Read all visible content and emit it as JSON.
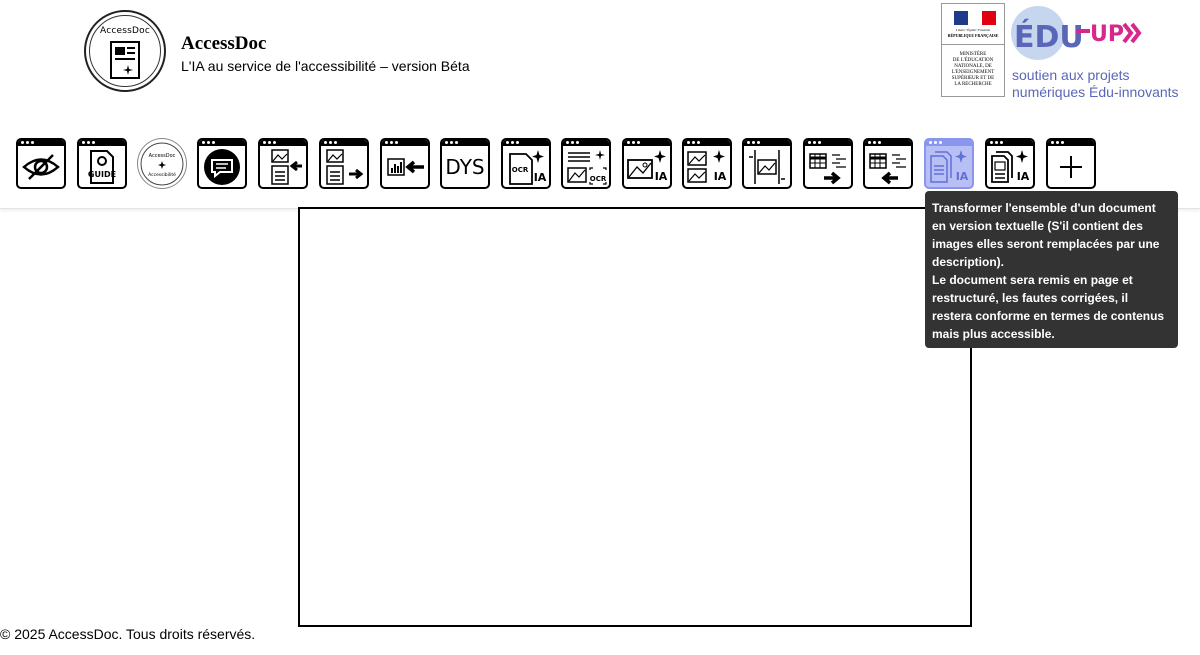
{
  "header": {
    "logo_text": "AccessDoc",
    "title": "AccessDoc",
    "subtitle": "L'IA au service de l'accessibilité – version Béta",
    "republic_logo": {
      "motto": "Liberté • Égalité • Fraternité",
      "republic": "RÉPUBLIQUE FRANÇAISE",
      "ministry": "MINISTÈRE\nDE L'ÉDUCATION\nNATIONALE, DE\nL'ENSEIGNEMENT\nSUPÉRIEUR ET DE\nLA RECHERCHE"
    },
    "eduup": {
      "name": "ÉDU-UP",
      "tagline_line1": "soutien aux projets",
      "tagline_line2": "numériques Édu-innovants"
    }
  },
  "toolbar": {
    "tools": [
      {
        "icon": "eye-slash-icon"
      },
      {
        "icon": "guide-icon",
        "label": "GUIDE"
      },
      {
        "icon": "accessdoc-logo-icon",
        "label": "AccessDoc"
      },
      {
        "icon": "chat-bubble-icon"
      },
      {
        "icon": "image-to-text-icon"
      },
      {
        "icon": "text-to-image-icon"
      },
      {
        "icon": "chart-to-text-icon"
      },
      {
        "icon": "dys-icon",
        "label": "DYS"
      },
      {
        "icon": "ocr-ia-icon",
        "label": "IA"
      },
      {
        "icon": "document-ocr-icon"
      },
      {
        "icon": "image-ia-icon",
        "label": "IA"
      },
      {
        "icon": "images-ia-icon",
        "label": "IA"
      },
      {
        "icon": "image-crop-icon"
      },
      {
        "icon": "table-to-text-icon"
      },
      {
        "icon": "text-to-table-icon"
      },
      {
        "icon": "document-to-text-ia-icon",
        "label": "IA",
        "active": true
      },
      {
        "icon": "document-with-images-ia-icon",
        "label": "IA"
      },
      {
        "icon": "plus-icon"
      }
    ]
  },
  "tooltip": {
    "line1": "Transformer l'ensemble d'un document en version textuelle (S'il contient des images elles seront remplacées par une description).",
    "line2": "Le document sera remis en page et restructuré, les fautes corrigées, il restera conforme en termes de contenus mais plus accessible."
  },
  "footer": {
    "text": "© 2025 AccessDoc. Tous droits réservés."
  },
  "colors": {
    "active_tool": "#b7bff5",
    "tooltip_bg": "#333333",
    "eduup_blue": "#5a67b8",
    "eduup_pink": "#d9268a"
  }
}
